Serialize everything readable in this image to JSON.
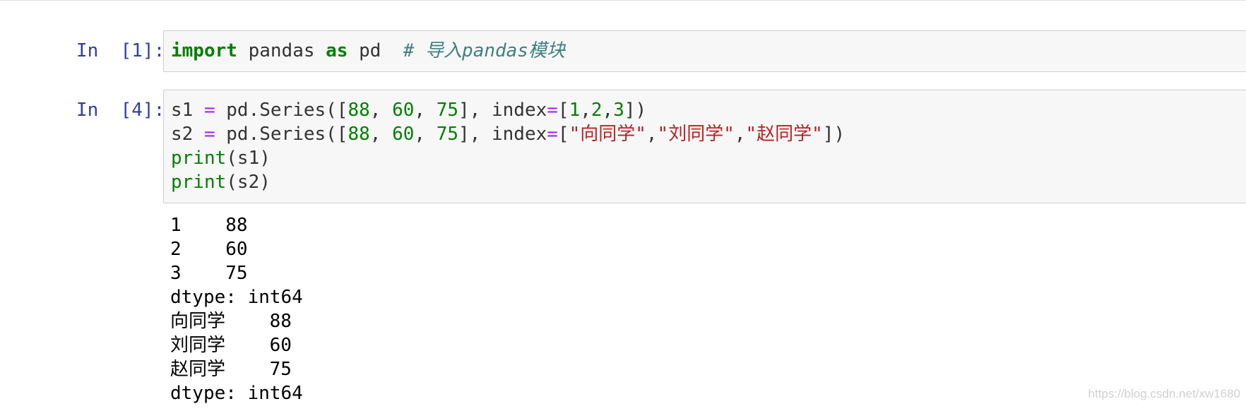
{
  "cells": [
    {
      "prompt": "In  [1]:",
      "code": {
        "kw_import": "import",
        "mod": " pandas ",
        "kw_as": "as",
        "alias": " pd  ",
        "comment": "# 导入pandas模块"
      }
    },
    {
      "prompt": "In  [4]:",
      "lines": [
        {
          "var": "s1 ",
          "eq": "=",
          "call": " pd.Series([",
          "n1": "88",
          "c1": ", ",
          "n2": "60",
          "c2": ", ",
          "n3": "75",
          "mid": "], index",
          "eq2": "=",
          "lb": "[",
          "i1": "1",
          "s1": ",",
          "i2": "2",
          "s2": ",",
          "i3": "3",
          "end": "])"
        },
        {
          "var": "s2 ",
          "eq": "=",
          "call": " pd.Series([",
          "n1": "88",
          "c1": ", ",
          "n2": "60",
          "c2": ", ",
          "n3": "75",
          "mid": "], index",
          "eq2": "=",
          "lb": "[",
          "str1": "\"向同学\"",
          "s1": ",",
          "str2": "\"刘同学\"",
          "s2": ",",
          "str3": "\"赵同学\"",
          "end": "])"
        },
        {
          "fn": "print",
          "arg": "(s1)"
        },
        {
          "fn": "print",
          "arg": "(s2)"
        }
      ],
      "output": [
        "1    88",
        "2    60",
        "3    75",
        "dtype: int64",
        "向同学    88",
        "刘同学    60",
        "赵同学    75",
        "dtype: int64"
      ]
    }
  ],
  "watermark": "https://blog.csdn.net/xw1680",
  "colors": {
    "prompt": "#303f9f",
    "keyword": "#008000",
    "operator": "#aa22ff",
    "string": "#ba2121",
    "comment": "#408080",
    "input_bg": "#f7f7f7",
    "input_border": "#cfcfcf"
  }
}
